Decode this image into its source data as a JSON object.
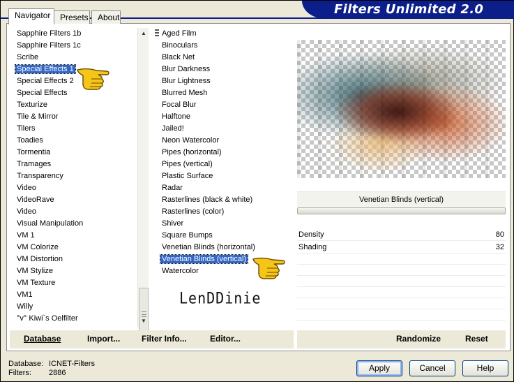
{
  "window": {
    "title": "Filters Unlimited 2.0"
  },
  "tabs": [
    {
      "label": "Navigator",
      "active": true
    },
    {
      "label": "Presets",
      "active": false
    },
    {
      "label": "About",
      "active": false
    }
  ],
  "categories": {
    "items": [
      "Sapphire Filters 1b",
      "Sapphire Filters 1c",
      "Scribe",
      "Special Effects 1",
      "Special Effects 2",
      "Special Effects",
      "Texturize",
      "Tile & Mirror",
      "Tilers",
      "Toadies",
      "Tormentia",
      "Tramages",
      "Transparency",
      "Video",
      "VideoRave",
      "Video",
      "Visual Manipulation",
      "VM 1",
      "VM Colorize",
      "VM Distortion",
      "VM Stylize",
      "VM Texture",
      "VM1",
      "Willy",
      "°v° Kiwi`s Oelfilter"
    ],
    "selected_index": 3
  },
  "filters": {
    "items": [
      "Aged Film",
      "Binoculars",
      "Black Net",
      "Blur Darkness",
      "Blur Lightness",
      "Blurred Mesh",
      "Focal Blur",
      "Halftone",
      "Jailed!",
      "Neon Watercolor",
      "Pipes (horizontal)",
      "Pipes (vertical)",
      "Plastic Surface",
      "Radar",
      "Rasterlines (black & white)",
      "Rasterlines (color)",
      "Shiver",
      "Square Bumps",
      "Venetian Blinds (horizontal)",
      "Venetian Blinds (vertical)",
      "Watercolor"
    ],
    "selected_index": 19
  },
  "logo_text": "LenDDinie",
  "effect": {
    "title": "Venetian Blinds (vertical)",
    "params": [
      {
        "label": "Density",
        "value": "80"
      },
      {
        "label": "Shading",
        "value": "32"
      }
    ]
  },
  "left_buttons": {
    "database": "Database",
    "import": "Import...",
    "filter_info": "Filter Info...",
    "editor": "Editor..."
  },
  "right_buttons": {
    "randomize": "Randomize",
    "reset": "Reset"
  },
  "info": {
    "database_label": "Database:",
    "database_value": "ICNET-Filters",
    "filters_label": "Filters:",
    "filters_value": "2886"
  },
  "dialog_buttons": {
    "apply": "Apply",
    "cancel": "Cancel",
    "help": "Help"
  },
  "colors": {
    "banner": "#0b1e8a",
    "selection": "#3166c4",
    "hand": "#f5c518"
  }
}
